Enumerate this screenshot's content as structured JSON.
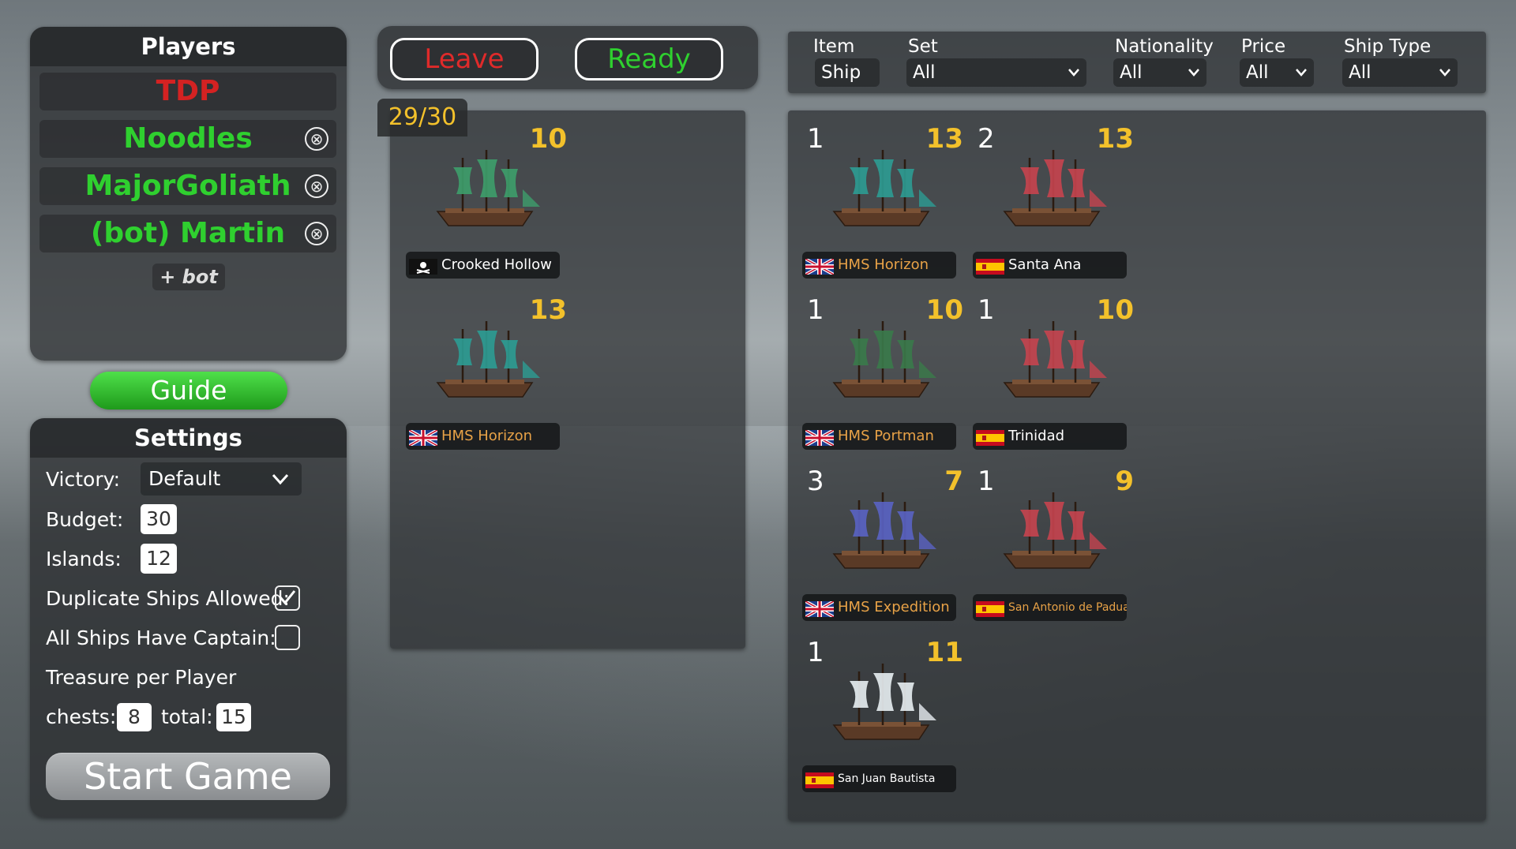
{
  "players": {
    "title": "Players",
    "list": [
      {
        "name": "TDP",
        "color": "#d42222",
        "kickable": false
      },
      {
        "name": "Noodles",
        "color": "#2fd02f",
        "kickable": true
      },
      {
        "name": "MajorGoliath",
        "color": "#2fd02f",
        "kickable": true
      },
      {
        "name": "(bot) Martin",
        "color": "#2fd02f",
        "kickable": true
      }
    ],
    "kick_icon": "⊗",
    "add_bot_label": "+ bot"
  },
  "guide_label": "Guide",
  "settings": {
    "title": "Settings",
    "victory_label": "Victory:",
    "victory_value": "Default",
    "budget_label": "Budget:",
    "budget_value": "30",
    "islands_label": "Islands:",
    "islands_value": "12",
    "duplicate_label": "Duplicate Ships Allowed:",
    "duplicate_checked": true,
    "captain_label": "All Ships Have Captain:",
    "captain_checked": false,
    "treasure_label": "Treasure per Player",
    "chests_label": "chests:",
    "chests_value": "8",
    "total_label": "total:",
    "total_value": "15",
    "start_label": "Start Game"
  },
  "buttons": {
    "leave_label": "Leave",
    "ready_label": "Ready"
  },
  "fleet": {
    "budget_display": "29/30",
    "ships": [
      {
        "price": "10",
        "name": "Crooked Hollow",
        "flag": "pirate",
        "sail_color": "#3d9e6c",
        "name_color": "#ffffff"
      },
      {
        "price": "13",
        "name": "HMS Horizon",
        "flag": "uk",
        "sail_color": "#2c9c94",
        "name_color": "#e8a247"
      }
    ]
  },
  "filters": {
    "item_label": "Item",
    "item_value": "Ship",
    "set_label": "Set",
    "set_value": "All",
    "nationality_label": "Nationality",
    "nationality_value": "All",
    "price_label": "Price",
    "price_value": "All",
    "type_label": "Ship Type",
    "type_value": "All"
  },
  "catalog": {
    "ships": [
      {
        "qty": "1",
        "price": "13",
        "name": "HMS Horizon",
        "flag": "uk",
        "sail_color": "#2c9c94",
        "name_color": "#e8a247"
      },
      {
        "qty": "2",
        "price": "13",
        "name": "Santa Ana",
        "flag": "spain",
        "sail_color": "#c6444f",
        "name_color": "#ffffff"
      },
      {
        "qty": "1",
        "price": "10",
        "name": "HMS Portman",
        "flag": "uk",
        "sail_color": "#3a7a4a",
        "name_color": "#e8a247"
      },
      {
        "qty": "1",
        "price": "10",
        "name": "Trinidad",
        "flag": "spain",
        "sail_color": "#c6444f",
        "name_color": "#ffffff"
      },
      {
        "qty": "3",
        "price": "7",
        "name": "HMS Expedition",
        "flag": "uk",
        "sail_color": "#5a63c4",
        "name_color": "#e8a247"
      },
      {
        "qty": "1",
        "price": "9",
        "name": "San Antonio de Padua",
        "flag": "spain",
        "sail_color": "#c6444f",
        "name_color": "#e8a247"
      },
      {
        "qty": "1",
        "price": "11",
        "name": "San Juan Bautista",
        "flag": "spain",
        "sail_color": "#e8eef2",
        "name_color": "#ffffff"
      }
    ]
  },
  "colors": {
    "accent_yellow": "#f3c12b",
    "green": "#2fd02f",
    "red": "#d42222"
  }
}
